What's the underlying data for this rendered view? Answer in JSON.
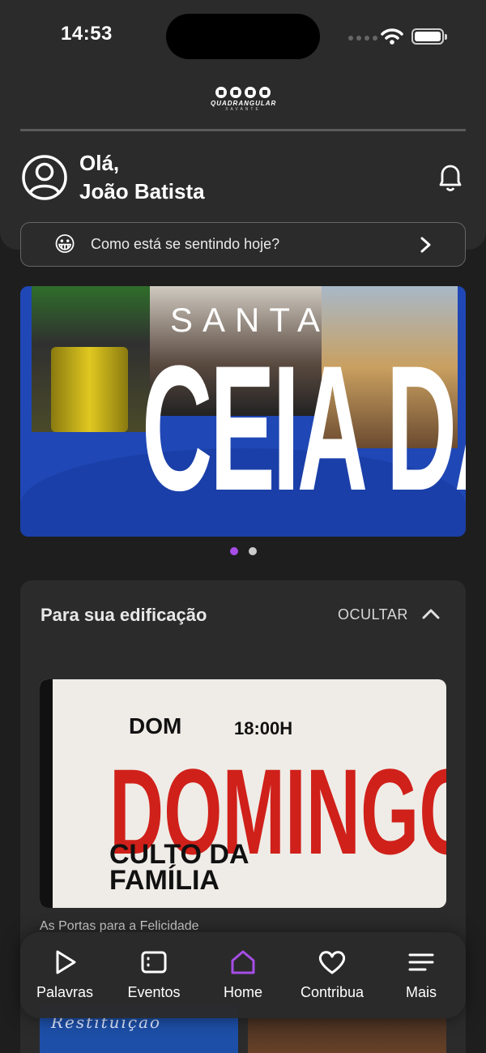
{
  "status_bar": {
    "time": "14:53"
  },
  "logo": {
    "title": "QUADRANGULAR",
    "subtitle": "XAVANTE"
  },
  "header": {
    "greeting_line1": "Olá,",
    "greeting_line2": "João Batista"
  },
  "mood": {
    "emoji": "😀",
    "prompt": "Como está se sentindo hoje?"
  },
  "banner": {
    "line1": "SANTA",
    "line2": "CEIA DA"
  },
  "carousel": {
    "current": 1,
    "total": 2
  },
  "edification": {
    "title": "Para sua edificação",
    "hide_label": "OCULTAR",
    "video": {
      "day": "DOM",
      "time": "18:00H",
      "headline": "DOMINGO",
      "subtitle_line1": "CULTO DA",
      "subtitle_line2": "FAMÍLIA",
      "caption": "As Portas para a Felicidade"
    },
    "next_thumb_text": "Restituição"
  },
  "tabbar": {
    "items": [
      {
        "label": "Palavras",
        "icon": "play-icon"
      },
      {
        "label": "Eventos",
        "icon": "calendar-list-icon"
      },
      {
        "label": "Home",
        "icon": "home-icon",
        "active": true
      },
      {
        "label": "Contribua",
        "icon": "heart-icon"
      },
      {
        "label": "Mais",
        "icon": "menu-icon"
      }
    ],
    "active_color": "#a64ee6"
  },
  "colors": {
    "background": "#1e1e1e",
    "panel": "#2b2b2b",
    "accent": "#a64ee6"
  }
}
